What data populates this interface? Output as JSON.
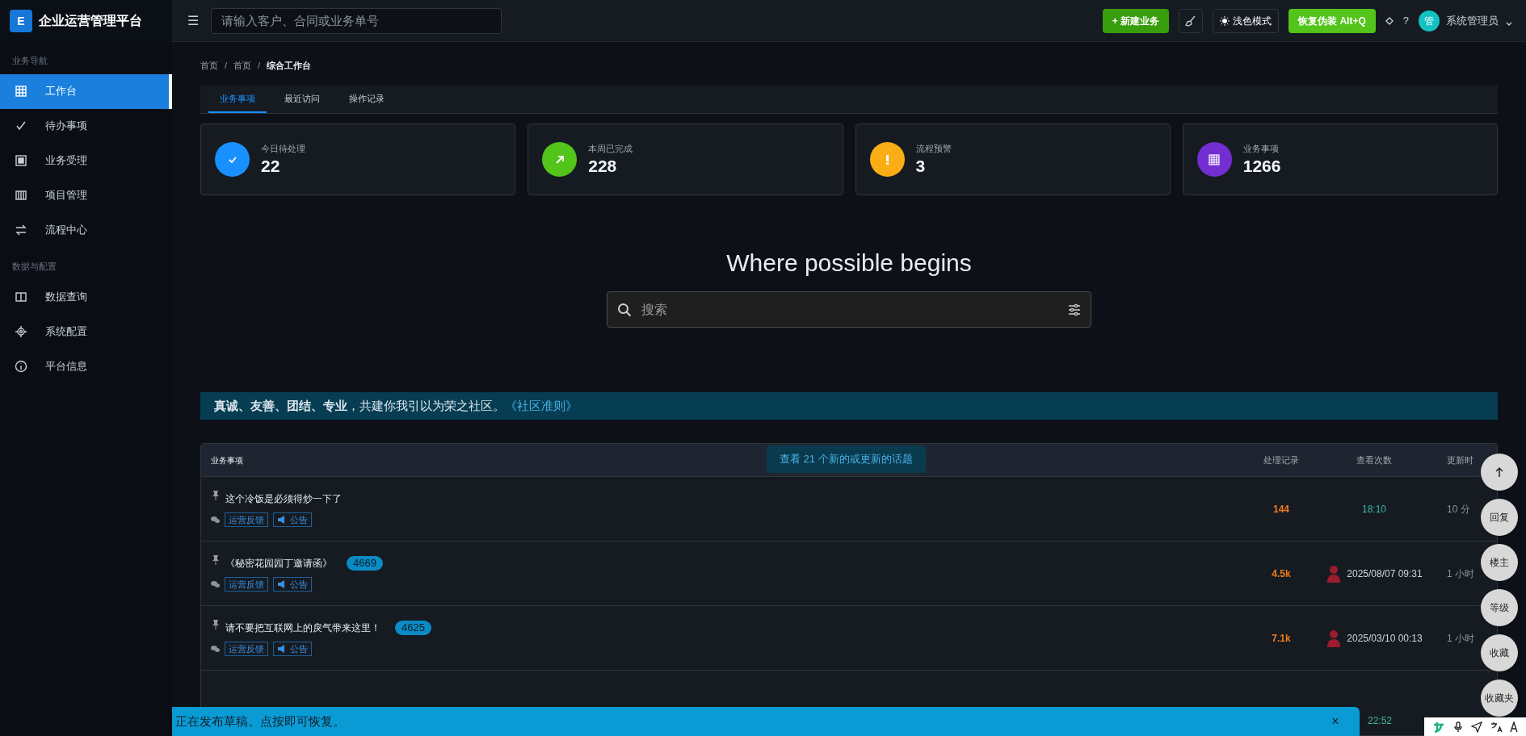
{
  "app": {
    "logo_letter": "E",
    "title": "企业运营管理平台"
  },
  "topbar": {
    "menu_glyph": "☰",
    "search_placeholder": "请输入客户、合同或业务单号",
    "new_button": "+ 新建业务",
    "theme_button": "浅色模式",
    "disguise_button": "恢复伪装 Alt+Q",
    "help_glyph": "?",
    "avatar_letter": "管",
    "user_name": "系统管理员"
  },
  "sidebar": {
    "groups": [
      {
        "heading": "业务导航",
        "items": [
          {
            "label": "工作台",
            "selected": true
          },
          {
            "label": "待办事项",
            "selected": false
          },
          {
            "label": "业务受理",
            "selected": false
          },
          {
            "label": "项目管理",
            "selected": false
          },
          {
            "label": "流程中心",
            "selected": false
          }
        ]
      },
      {
        "heading": "数据与配置",
        "items": [
          {
            "label": "数据查询",
            "selected": false
          },
          {
            "label": "系统配置",
            "selected": false
          },
          {
            "label": "平台信息",
            "selected": false
          }
        ]
      }
    ]
  },
  "breadcrumb": {
    "separator": "/",
    "items": [
      "首页",
      "首页",
      "综合工作台"
    ]
  },
  "tabs": [
    {
      "label": "业务事项",
      "selected": true
    },
    {
      "label": "最近访问",
      "selected": false
    },
    {
      "label": "操作记录",
      "selected": false
    }
  ],
  "stats": [
    {
      "label": "今日待处理",
      "value": "22",
      "color": "#1890ff"
    },
    {
      "label": "本周已完成",
      "value": "228",
      "color": "#52c41a"
    },
    {
      "label": "流程预警",
      "value": "3",
      "color": "#faad14"
    },
    {
      "label": "业务事项",
      "value": "1266",
      "color": "#722ed1"
    }
  ],
  "hero": {
    "title": "Where possible begins",
    "search_placeholder": "搜索"
  },
  "banner": {
    "text": "**真诚、友善、团结、专业**，共建你我引以为荣之社区。",
    "link": "《社区准则》"
  },
  "table": {
    "columns": [
      "业务事项",
      "处理记录",
      "查看次数",
      "更新时"
    ],
    "new_topics_button": "查看 21 个新的或更新的话题",
    "rows": [
      {
        "title": "这个冷饭是必须得炒一下了",
        "tags": [
          "运营反馈",
          "公告"
        ],
        "replies": "144",
        "kind": "time",
        "views": "18:10",
        "updated": "10 分"
      },
      {
        "title": "《秘密花园园丁邀请函》",
        "badge": "4669",
        "tags": [
          "运营反馈",
          "公告"
        ],
        "replies": "4.5k",
        "kind": "user",
        "views": "2025/08/07 09:31",
        "updated": "1 小时"
      },
      {
        "title": "请不要把互联网上的戾气带来这里！",
        "badge": "4625",
        "tags": [
          "运营反馈",
          "公告"
        ],
        "replies": "7.1k",
        "kind": "user",
        "views": "2025/03/10 00:13",
        "updated": "1 小时"
      }
    ]
  },
  "float_buttons": [
    {
      "kind": "icon"
    },
    {
      "kind": "text",
      "label": "回复"
    },
    {
      "kind": "text",
      "label": "楼主"
    },
    {
      "kind": "text",
      "label": "等级"
    },
    {
      "kind": "text",
      "label": "收藏"
    },
    {
      "kind": "text",
      "label": "收藏夹"
    }
  ],
  "draft_bar": {
    "text": "正在发布草稿。点按即可恢复。",
    "close": "×"
  },
  "clock": "22:52"
}
